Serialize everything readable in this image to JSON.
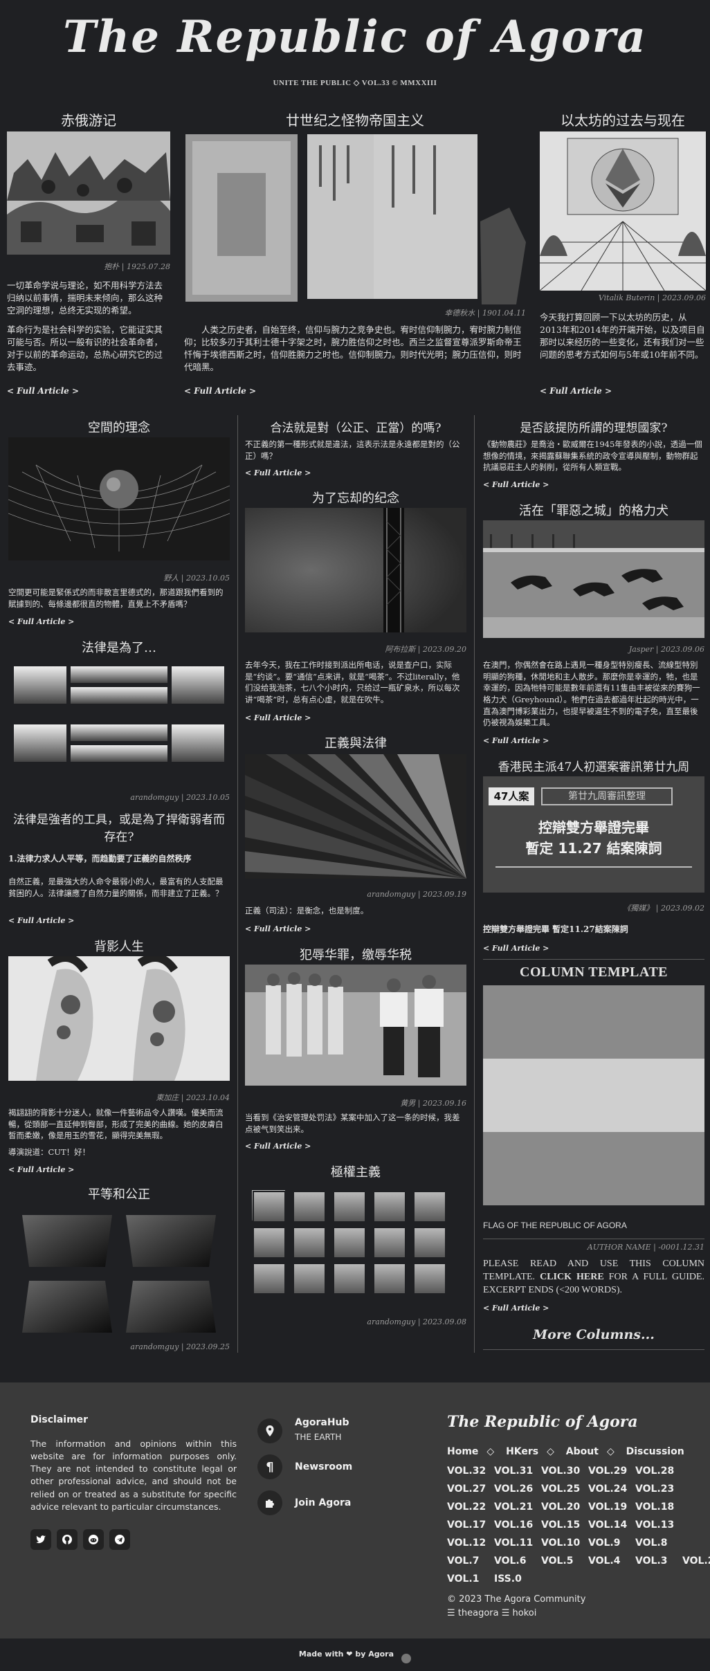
{
  "masthead": {
    "title": "The Republic of Agora",
    "tagline": "UNITE THE PUBLIC ◇ VOL.33 © MMXXIII"
  },
  "top": {
    "left": {
      "title": "赤俄游记",
      "caption": "抱朴 | 1925.07.28",
      "text": "一切革命学说与理论，如不用科学方法去归纳以前事情，揣明未来倾向，那么这种空洞的理想，总终无实现的希望。",
      "text2": "革命行为是社会科学的实验，它能证实其可能与否。所以一般有识的社会革命者，对于以前的革命运动，总热心研究它的过去事迹。",
      "link": "< Full Article >"
    },
    "center": {
      "title": "廿世纪之怪物帝国主义",
      "caption": "幸德秋水 | 1901.04.11",
      "text": "人类之历史者，自始至终，信仰与腕力之竞争史也。宥时信仰制腕力，宥时腕力制信仰；比较多刃于其利士德十字架之时，腕力胜信仰之时也。西兰之监督宣尊派罗斯命帝王忏悔于埃德西斯之时，信仰胜腕力之时也。信仰制腕力。则时代光明；腕力压信仰，则时代暗黑。",
      "link": "< Full Article >"
    },
    "right": {
      "title": "以太坊的过去与现在",
      "caption": "Vitalik Buterin | 2023.09.06",
      "text": "今天我打算回顾一下以太坊的历史，从2013年和2014年的开端开始，以及项目自那时以来经历的一些变化，还有我们对一些问题的思考方式如何与5年或10年前不同。",
      "link": "< Full Article >"
    }
  },
  "col1": [
    {
      "title": "空間的理念",
      "caption": "野人 | 2023.10.05",
      "text": "空間更可能是緊係式的而非散言里德式的，那道跟我們看到的賦據到的、每條邊都很直的物體，直覺上不矛盾嗎？",
      "link": "< Full Article >"
    },
    {
      "title": "法律是為了…",
      "caption": "arandomguy | 2023.10.05"
    },
    {
      "title": "法律是強者的工具，或是為了捍衛弱者而存在?",
      "sub": "1.法律力求人人平等，而趋勤要了正義的自然秩序",
      "text": "自然正義，是最強大的人命令最弱小的人，最富有的人支配最貧困的人。法律讓應了自然力量的關係，而非建立了正義。？",
      "link": "< Full Article >"
    },
    {
      "title": "背影人生",
      "caption": "東加庄 | 2023.10.04",
      "text": "褐翃翃的背影十分迷人，就像一件藝術品令人讚嘆。優美而流暢，從頭部一直延伸到臀部，形成了完美的曲線。她的皮膚白皙而柔嫩，像是用玉的雪花，顯得完美無瑕。",
      "text2": "導演說道：CUT！好！",
      "link": "< Full Article >"
    },
    {
      "title": "平等和公正",
      "caption": "arandomguy | 2023.09.25"
    }
  ],
  "col2": [
    {
      "title": "合法就是對（公正、正當）的嗎?",
      "text": "不正義的第一種形式就是違法，這表示法是永遠都是對的（公正）嗎？",
      "link": "< Full Article >"
    },
    {
      "title": "为了忘却的纪念",
      "caption": "阿布拉斯 | 2023.09.20",
      "text": "去年今天，我在工作时接到派出所电话，说是查户口，实际是“约谈”。要“通信”点来讲，就是“喝茶”。不过literally，他们没给我泡茶，七八个小时内，只给过一瓶矿泉水，所以每次讲“喝茶”时，总有点心虚，就是在吹牛。",
      "link": "< Full Article >"
    },
    {
      "title": "正義與法律",
      "caption": "arandomguy | 2023.09.19",
      "text": "正義（司法）：是衡念，也是制度。",
      "link": "< Full Article >"
    },
    {
      "title": "犯辱华罪，缴辱华税",
      "caption": "黄男 | 2023.09.16",
      "text": "当看到《治安管理处罚法》某案中加入了这一条的时候，我差点被气到笑出来。",
      "link": "< Full Article >"
    },
    {
      "title": "極權主義",
      "caption": "arandomguy | 2023.09.08"
    }
  ],
  "col3": [
    {
      "title": "是否該提防所謂的理想國家?",
      "text": "《動物農莊》是喬治・歐威爾在1945年發表的小說，透過一個想像的情境，來揭露蘇聯集系統的政令宣導與壓制，動物群起抗議惡莊主人的剝削，從所有人類宣戰。",
      "link": "< Full Article >"
    },
    {
      "title": "活在「罪惡之城」的格力犬",
      "caption": "Jasper | 2023.09.06",
      "text": "在澳門，你偶然會在路上遇見一種身型特別瘦長、流線型特別明顯的狗種，休閒地和主人散步。那麼你是幸運的，牠，也是幸運的，因為牠特可能是數年前還有11隻由丰被從來的賽狗一格力犬（Greyhound）。牠們在過去都過年壯起的時光中，一直為澳門博彩業出力，也提早被逼生不到的電子免，直至最後仍被視為娛樂工具。",
      "link": "< Full Article >"
    },
    {
      "title": "香港民主派47人初選案審訊第廿九周",
      "caption": "《獨媒》 | 2023.09.02",
      "text": "控辯雙方舉證完畢 暫定11.27結案陳詞",
      "link": "< Full Article >",
      "img_badge": "47人案",
      "img_header": "第廿九周審訊整理",
      "img_line1": "控辯雙方舉證完畢",
      "img_line2": "暫定 11.27 結案陳詞"
    },
    {
      "title": "COLUMN TEMPLATE",
      "flag_caption": "FLAG OF THE REPUBLIC OF AGORA",
      "caption": "AUTHOR NAME | -0001.12.31",
      "text_a": "PLEASE READ AND USE THIS COLUMN TEMPLATE.",
      "click": "CLICK HERE",
      "text_b": "FOR A FULL GUIDE. EXCERPT ENDS (<200 WORDS).",
      "link": "< Full Article >"
    },
    {
      "more": "More Columns..."
    }
  ],
  "footer": {
    "disclaimer_title": "Disclaimer",
    "disclaimer_text": "The information and opinions within this website are for information purposes only. They are not intended to constitute legal or other professional advice, and should not be relied on or treated as a substitute for specific advice relevant to particular circumstances.",
    "links": [
      {
        "label": "AgoraHub",
        "sub": "THE EARTH",
        "icon": "map-pin-icon"
      },
      {
        "label": "Newsroom",
        "sub": "",
        "icon": "pilcrow-icon"
      },
      {
        "label": "Join Agora",
        "sub": "",
        "icon": "puzzle-icon"
      }
    ],
    "brand": "The Republic of Agora",
    "nav": [
      "Home",
      "HKers",
      "About",
      "Discussion"
    ],
    "vols": [
      [
        "VOL.32",
        "VOL.31",
        "VOL.30",
        "VOL.29",
        "VOL.28"
      ],
      [
        "VOL.27",
        "VOL.26",
        "VOL.25",
        "VOL.24",
        "VOL.23"
      ],
      [
        "VOL.22",
        "VOL.21",
        "VOL.20",
        "VOL.19",
        "VOL.18"
      ],
      [
        "VOL.17",
        "VOL.16",
        "VOL.15",
        "VOL.14",
        "VOL.13"
      ],
      [
        "VOL.12",
        "VOL.11",
        "VOL.10",
        "VOL.9",
        "VOL.8"
      ],
      [
        "VOL.7",
        "VOL.6",
        "VOL.5",
        "VOL.4",
        "VOL.3",
        "VOL.2"
      ],
      [
        "VOL.1",
        "ISS.0"
      ]
    ],
    "copyright": "© 2023 The Agora Community",
    "credits": "☰ theagora ☰ hokoi",
    "made": "Made with ❤ by Agora"
  },
  "icons": [
    "twitter-icon",
    "github-icon",
    "reddit-icon",
    "telegram-icon"
  ]
}
